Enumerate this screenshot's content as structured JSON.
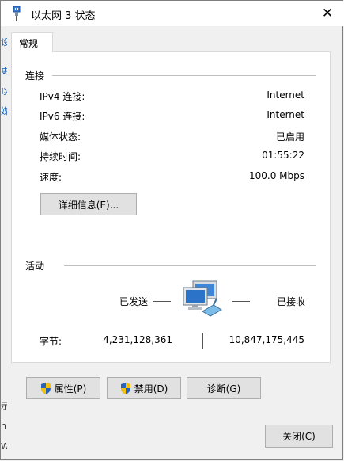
{
  "window": {
    "title": "以太网 3 状态",
    "close_glyph": "✕"
  },
  "background_peeks": [
    "设",
    "更",
    "以",
    "媒",
    "示",
    "n",
    "W"
  ],
  "tab": {
    "label": "常规"
  },
  "connection": {
    "group_label": "连接",
    "rows": [
      {
        "label": "IPv4 连接:",
        "value": "Internet"
      },
      {
        "label": "IPv6 连接:",
        "value": "Internet"
      },
      {
        "label": "媒体状态:",
        "value": "已启用"
      },
      {
        "label": "持续时间:",
        "value": "01:55:22"
      },
      {
        "label": "速度:",
        "value": "100.0 Mbps"
      }
    ],
    "details_button": "详细信息(E)..."
  },
  "activity": {
    "group_label": "活动",
    "sent_label": "已发送",
    "received_label": "已接收",
    "bytes_label": "字节:",
    "bytes_sent": "4,231,128,361",
    "bytes_received": "10,847,175,445"
  },
  "buttons": {
    "properties": "属性(P)",
    "disable": "禁用(D)",
    "diagnose": "诊断(G)",
    "close": "关闭(C)"
  },
  "icons": {
    "title": "network-adapter-icon",
    "shield": "uac-shield-icon",
    "network": "network-computers-icon"
  }
}
